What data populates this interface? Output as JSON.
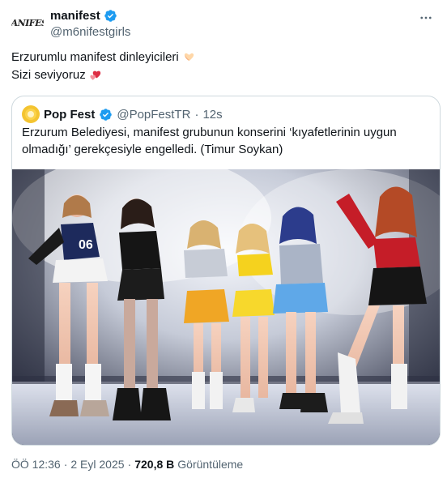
{
  "author": {
    "display_name": "manifest",
    "handle": "@m6nifestgirls",
    "avatar_text": "MANIFEST"
  },
  "tweet": {
    "line1": "Erzurumlu manifest dinleyicileri",
    "line2": "Sizi seviyoruz"
  },
  "quote": {
    "display_name": "Pop Fest",
    "handle": "@PopFestTR",
    "separator": "·",
    "time": "12s",
    "text": "Erzurum Belediyesi, manifest grubunun konserini ‘kıyafetlerinin uygun olmadığı’ gerekçesiyle engelledi. (Timur Soykan)"
  },
  "meta": {
    "time": "ÖÖ 12:36",
    "separator": "·",
    "date": "2 Eyl 2025",
    "separator2": "·",
    "views": "720,8 B",
    "views_label": "Görüntüleme"
  },
  "colors": {
    "verified": "#1d9bf0",
    "text": "#0f1419",
    "secondary": "#536471",
    "border": "#cfd9de"
  },
  "icons": {
    "verified": "verified-badge-icon",
    "more": "more-dots-icon",
    "heart_hands": "heart-hands-emoji-icon",
    "hearts": "two-hearts-emoji-icon"
  }
}
